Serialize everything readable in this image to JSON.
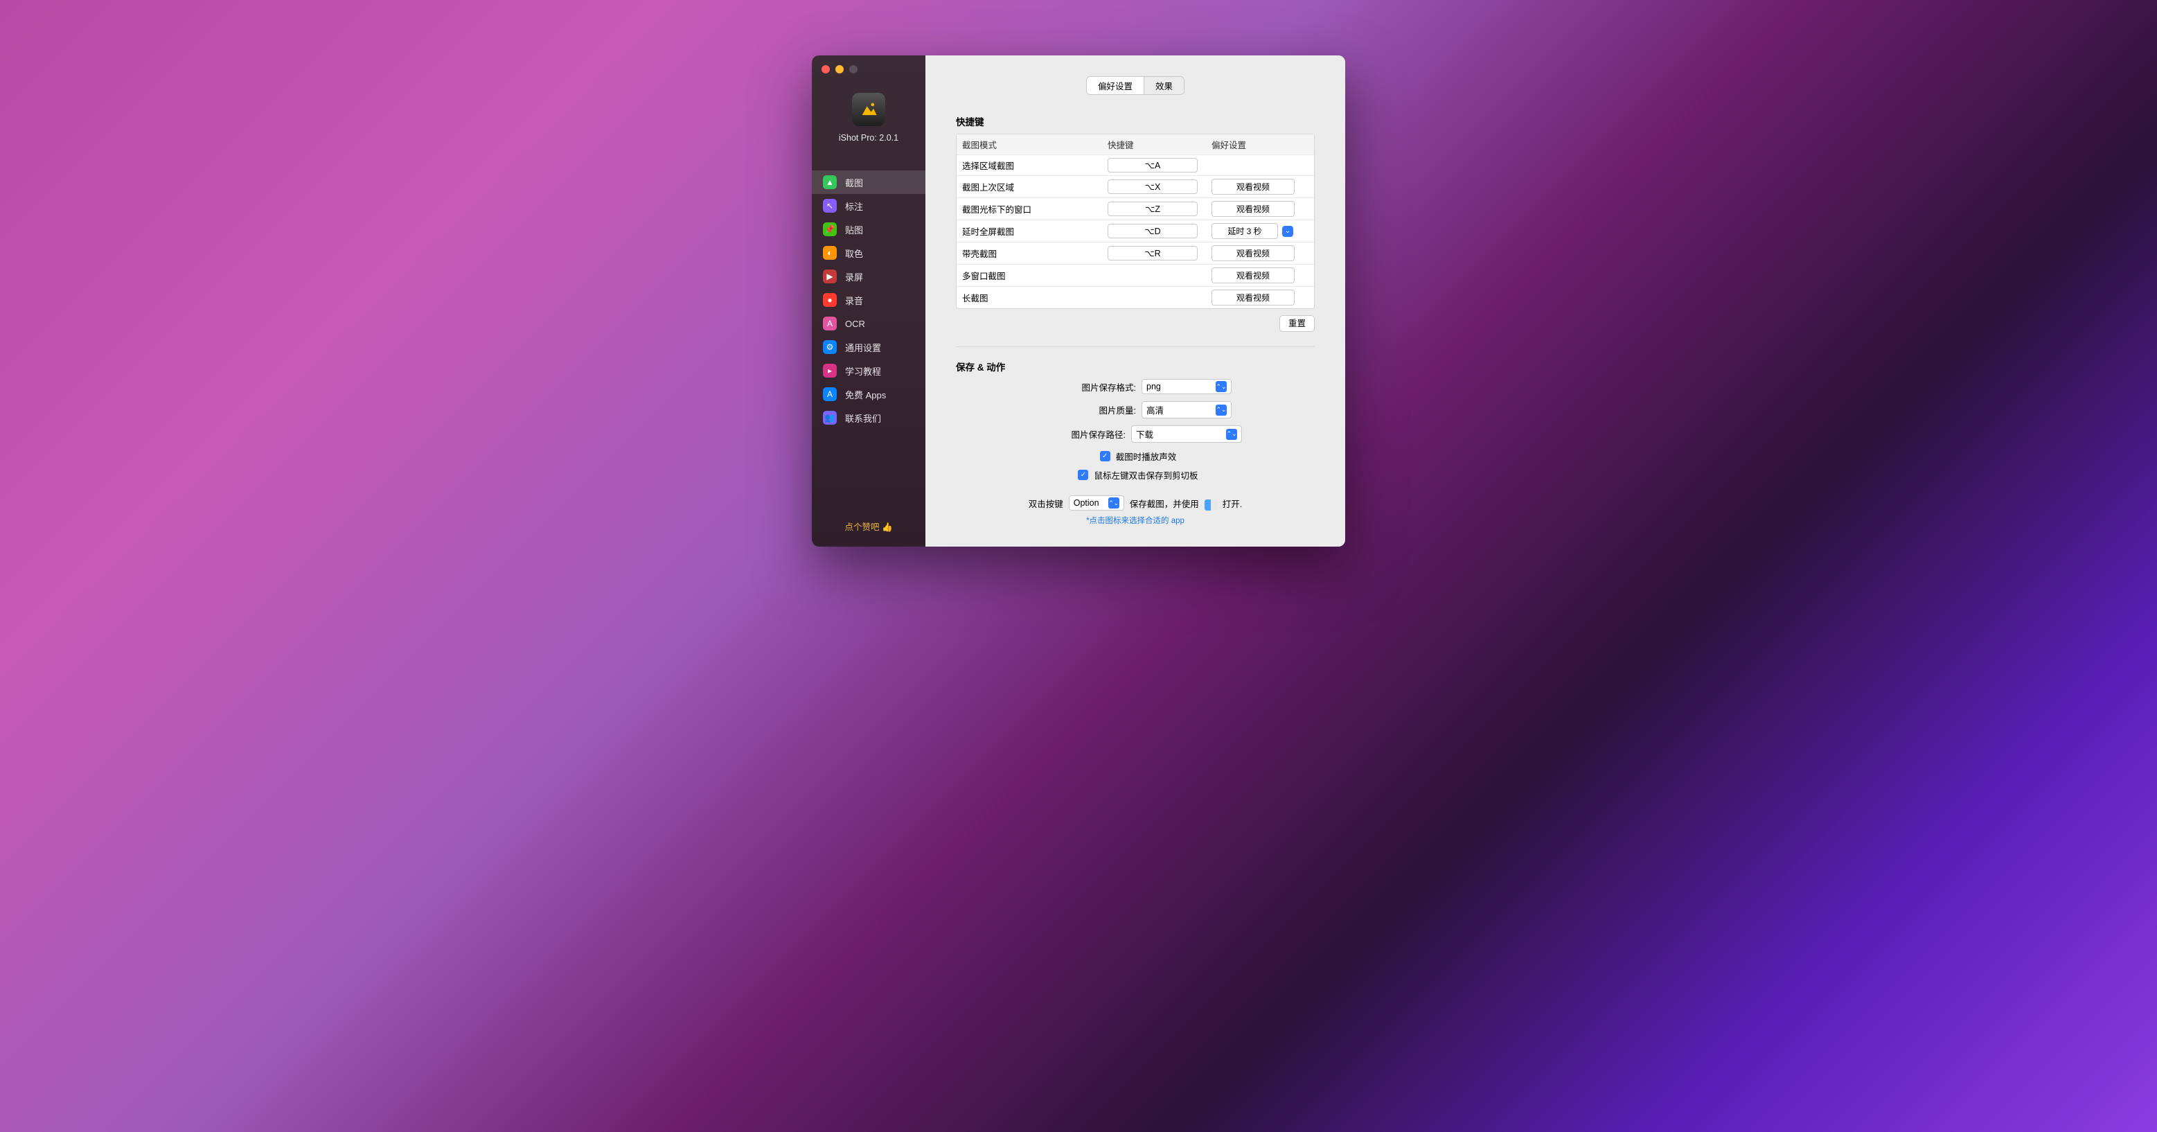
{
  "app": {
    "title": "iShot Pro: 2.0.1"
  },
  "sidebar": {
    "items": [
      {
        "label": "截图",
        "color": "#34c759"
      },
      {
        "label": "标注",
        "color": "#845ef7"
      },
      {
        "label": "贴图",
        "color": "#41c412"
      },
      {
        "label": "取色",
        "color": "#ff9500"
      },
      {
        "label": "录屏",
        "color": "#c33a3a"
      },
      {
        "label": "录音",
        "color": "#ff3b30"
      },
      {
        "label": "OCR",
        "color": "#e255a1"
      },
      {
        "label": "通用设置",
        "color": "#0a84ff"
      },
      {
        "label": "学习教程",
        "color": "#d63384"
      },
      {
        "label": "免费 Apps",
        "color": "#0a84ff"
      },
      {
        "label": "联系我们",
        "color": "#7a63ff"
      }
    ],
    "like": "点个赞吧 👍"
  },
  "tabs": {
    "pref": "偏好设置",
    "effect": "效果"
  },
  "shortcuts": {
    "title": "快捷键",
    "headers": {
      "mode": "截图模式",
      "key": "快捷键",
      "pref": "偏好设置"
    },
    "rows": [
      {
        "mode": "选择区域截图",
        "key": "⌥A",
        "pref": ""
      },
      {
        "mode": "截图上次区域",
        "key": "⌥X",
        "pref": "观看视频",
        "type": "watch"
      },
      {
        "mode": "截图光标下的窗口",
        "key": "⌥Z",
        "pref": "观看视频",
        "type": "watch"
      },
      {
        "mode": "延时全屏截图",
        "key": "⌥D",
        "pref": "延时 3 秒",
        "type": "delay"
      },
      {
        "mode": "带壳截图",
        "key": "⌥R",
        "pref": "观看视频",
        "type": "watch"
      },
      {
        "mode": "多窗口截图",
        "key": "",
        "pref": "观看视频",
        "type": "watch"
      },
      {
        "mode": "长截图",
        "key": "",
        "pref": "观看视频",
        "type": "watch"
      }
    ],
    "reset": "重置"
  },
  "save": {
    "title": "保存 & 动作",
    "format_label": "图片保存格式:",
    "format_value": "png",
    "quality_label": "图片质量:",
    "quality_value": "高清",
    "path_label": "图片保存路径:",
    "path_value": "下载",
    "sound_label": "截图时播放声效",
    "dblcopy_label": "鼠标左键双击保存到剪切板",
    "dblkey_pre": "双击按键",
    "dblkey_value": "Option",
    "dblkey_mid": "保存截图，并使用",
    "dblkey_suf": "打开.",
    "hint": "*点击图标来选择合适的 app"
  }
}
